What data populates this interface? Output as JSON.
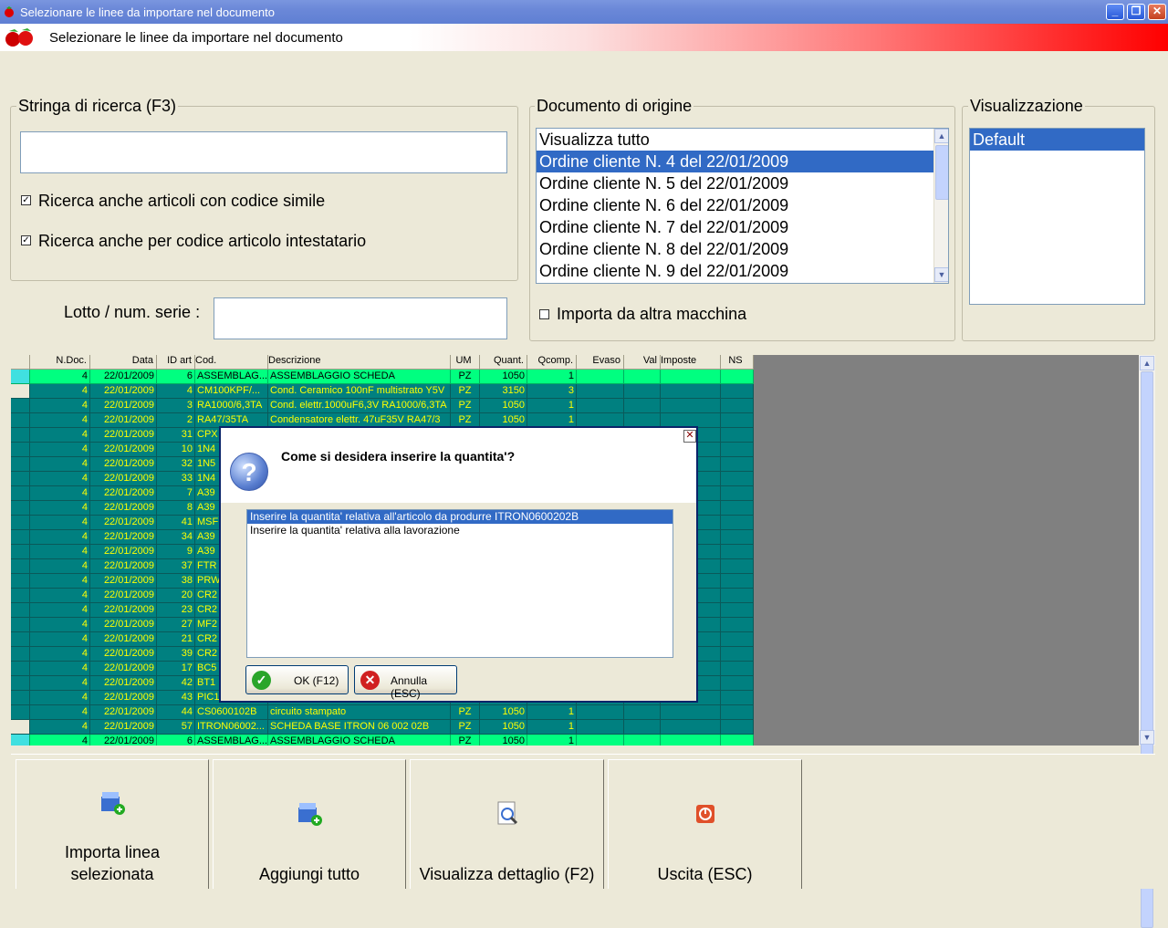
{
  "window": {
    "title": "Selezionare le linee da importare nel documento",
    "minimize": "_",
    "restore": "❐",
    "close": "✕"
  },
  "header": {
    "title": "Selezionare le linee da importare nel documento"
  },
  "search": {
    "label": "Stringa di ricerca (F3)",
    "value": "",
    "opt1_label": "Ricerca anche articoli con codice simile",
    "opt1_checked": true,
    "opt2_label": "Ricerca anche per codice articolo intestatario",
    "opt2_checked": true,
    "check_mark": "✓"
  },
  "lotto": {
    "label": "Lotto / num. serie :",
    "value": ""
  },
  "origine": {
    "label": "Documento di origine",
    "items": [
      "Visualizza tutto",
      "Ordine cliente N. 4 del 22/01/2009",
      "Ordine cliente N. 5 del 22/01/2009",
      "Ordine cliente N. 6 del 22/01/2009",
      "Ordine cliente N. 7 del 22/01/2009",
      "Ordine cliente N. 8 del 22/01/2009",
      "Ordine cliente N. 9 del 22/01/2009"
    ],
    "selected_index": 1,
    "other_machine_label": "Importa da altra macchina",
    "other_machine_checked": false
  },
  "visualizzazione": {
    "label": "Visualizzazione",
    "items": [
      "Default"
    ],
    "selected_index": 0
  },
  "grid": {
    "columns": [
      "N.Doc.",
      "Data",
      "ID art",
      "Cod.",
      "Descrizione",
      "UM",
      "Quant.",
      "Qcomp.",
      "Evaso",
      "Val",
      "Imposte",
      "NS"
    ],
    "rows": [
      {
        "ndoc": "4",
        "data": "22/01/2009",
        "id": "6",
        "cod": "ASSEMBLAG...",
        "desc": "ASSEMBLAGGIO SCHEDA",
        "um": "PZ",
        "quant": "1050",
        "qcomp": "1",
        "hl": true
      },
      {
        "ndoc": "4",
        "data": "22/01/2009",
        "id": "4",
        "cod": "CM100KPF/...",
        "desc": "Cond. Ceramico 100nF multistrato Y5V",
        "um": "PZ",
        "quant": "3150",
        "qcomp": "3",
        "hl": false
      },
      {
        "ndoc": "4",
        "data": "22/01/2009",
        "id": "3",
        "cod": "RA1000/6,3TA",
        "desc": "Cond. elettr.1000uF6,3V RA1000/6,3TA",
        "um": "PZ",
        "quant": "1050",
        "qcomp": "1",
        "hl": false
      },
      {
        "ndoc": "4",
        "data": "22/01/2009",
        "id": "2",
        "cod": "RA47/35TA",
        "desc": "Condensatore elettr. 47uF35V RA47/3",
        "um": "PZ",
        "quant": "1050",
        "qcomp": "1",
        "hl": false
      },
      {
        "ndoc": "4",
        "data": "22/01/2009",
        "id": "31",
        "cod": "CPX",
        "desc": "",
        "um": "",
        "quant": "",
        "qcomp": "",
        "hl": false
      },
      {
        "ndoc": "4",
        "data": "22/01/2009",
        "id": "10",
        "cod": "1N4",
        "desc": "",
        "um": "",
        "quant": "",
        "qcomp": "",
        "hl": false
      },
      {
        "ndoc": "4",
        "data": "22/01/2009",
        "id": "32",
        "cod": "1N5",
        "desc": "",
        "um": "",
        "quant": "",
        "qcomp": "",
        "hl": false
      },
      {
        "ndoc": "4",
        "data": "22/01/2009",
        "id": "33",
        "cod": "1N4",
        "desc": "",
        "um": "",
        "quant": "",
        "qcomp": "",
        "hl": false
      },
      {
        "ndoc": "4",
        "data": "22/01/2009",
        "id": "7",
        "cod": "A39",
        "desc": "",
        "um": "",
        "quant": "",
        "qcomp": "",
        "hl": false
      },
      {
        "ndoc": "4",
        "data": "22/01/2009",
        "id": "8",
        "cod": "A39",
        "desc": "",
        "um": "",
        "quant": "",
        "qcomp": "",
        "hl": false
      },
      {
        "ndoc": "4",
        "data": "22/01/2009",
        "id": "41",
        "cod": "MSF",
        "desc": "",
        "um": "",
        "quant": "",
        "qcomp": "",
        "hl": false
      },
      {
        "ndoc": "4",
        "data": "22/01/2009",
        "id": "34",
        "cod": "A39",
        "desc": "",
        "um": "",
        "quant": "",
        "qcomp": "",
        "hl": false
      },
      {
        "ndoc": "4",
        "data": "22/01/2009",
        "id": "9",
        "cod": "A39",
        "desc": "",
        "um": "",
        "quant": "",
        "qcomp": "",
        "hl": false
      },
      {
        "ndoc": "4",
        "data": "22/01/2009",
        "id": "37",
        "cod": "FTR",
        "desc": "",
        "um": "",
        "quant": "",
        "qcomp": "",
        "hl": false
      },
      {
        "ndoc": "4",
        "data": "22/01/2009",
        "id": "38",
        "cod": "PRW",
        "desc": "",
        "um": "",
        "quant": "",
        "qcomp": "",
        "hl": false
      },
      {
        "ndoc": "4",
        "data": "22/01/2009",
        "id": "20",
        "cod": "CR2",
        "desc": "",
        "um": "",
        "quant": "",
        "qcomp": "",
        "hl": false
      },
      {
        "ndoc": "4",
        "data": "22/01/2009",
        "id": "23",
        "cod": "CR2",
        "desc": "",
        "um": "",
        "quant": "",
        "qcomp": "",
        "hl": false
      },
      {
        "ndoc": "4",
        "data": "22/01/2009",
        "id": "27",
        "cod": "MF2",
        "desc": "",
        "um": "",
        "quant": "",
        "qcomp": "",
        "hl": false
      },
      {
        "ndoc": "4",
        "data": "22/01/2009",
        "id": "21",
        "cod": "CR2",
        "desc": "",
        "um": "",
        "quant": "",
        "qcomp": "",
        "hl": false
      },
      {
        "ndoc": "4",
        "data": "22/01/2009",
        "id": "39",
        "cod": "CR2",
        "desc": "",
        "um": "",
        "quant": "",
        "qcomp": "",
        "hl": false
      },
      {
        "ndoc": "4",
        "data": "22/01/2009",
        "id": "17",
        "cod": "BC5",
        "desc": "",
        "um": "",
        "quant": "",
        "qcomp": "",
        "hl": false
      },
      {
        "ndoc": "4",
        "data": "22/01/2009",
        "id": "42",
        "cod": "BT1",
        "desc": "",
        "um": "",
        "quant": "",
        "qcomp": "",
        "hl": false
      },
      {
        "ndoc": "4",
        "data": "22/01/2009",
        "id": "43",
        "cod": "PIC1",
        "desc": "",
        "um": "",
        "quant": "",
        "qcomp": "",
        "hl": false
      },
      {
        "ndoc": "4",
        "data": "22/01/2009",
        "id": "44",
        "cod": "CS0600102B",
        "desc": "circuito stampato",
        "um": "PZ",
        "quant": "1050",
        "qcomp": "1",
        "hl": false
      },
      {
        "ndoc": "4",
        "data": "22/01/2009",
        "id": "57",
        "cod": "ITRON06002...",
        "desc": "SCHEDA BASE ITRON 06 002 02B",
        "um": "PZ",
        "quant": "1050",
        "qcomp": "1",
        "hl": false
      },
      {
        "ndoc": "4",
        "data": "22/01/2009",
        "id": "6",
        "cod": "ASSEMBLAG...",
        "desc": "ASSEMBLAGGIO SCHEDA",
        "um": "PZ",
        "quant": "1050",
        "qcomp": "1",
        "hl": true
      }
    ]
  },
  "buttons": {
    "import_line": "Importa linea selezionata",
    "add_all": "Aggiungi tutto",
    "view_detail": "Visualizza dettaglio (F2)",
    "exit": "Uscita (ESC)"
  },
  "dialog": {
    "close": "✕",
    "question_icon": "?",
    "message": "Come si desidera inserire la quantita'?",
    "options": [
      "Inserire la quantita' relativa all'articolo da produrre ITRON0600202B",
      "Inserire la quantita' relativa alla lavorazione"
    ],
    "selected_index": 0,
    "ok_label": "OK (F12)",
    "ok_icon": "✓",
    "cancel_label": "Annulla (ESC)",
    "cancel_icon": "✕"
  },
  "scroll_glyphs": {
    "up": "▲",
    "down": "▼"
  },
  "colors": {
    "grid_bg": "#008080",
    "grid_text": "#ffff00",
    "grid_highlight": "#00ff80",
    "selection": "#316ac5"
  }
}
